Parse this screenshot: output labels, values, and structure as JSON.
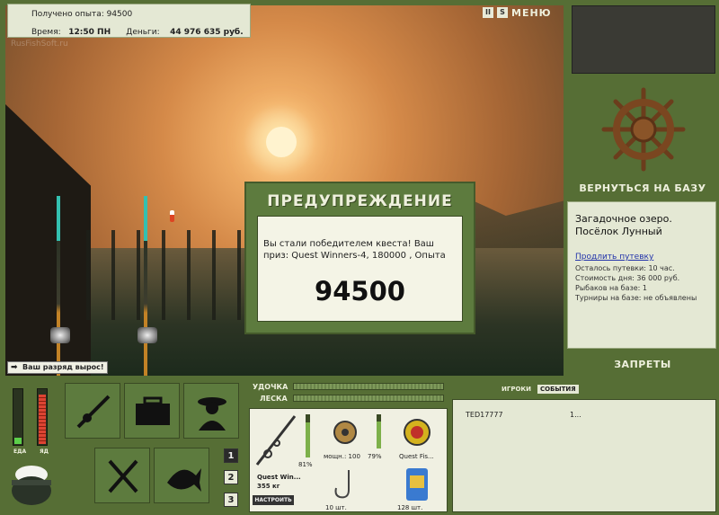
{
  "hud": {
    "xp_text": "Получено опыта: 94500",
    "time_label": "Время:",
    "time_value": "12:50 ПН",
    "money_label": "Деньги:",
    "money_value": "44 976 635 руб.",
    "pause_glyph": "II",
    "sound_glyph": "S",
    "menu_label": "МЕНЮ"
  },
  "scene": {
    "watermark": "RusFishSoft.ru"
  },
  "rank_notice": "Ваш разряд вырос!",
  "warning": {
    "title": "ПРЕДУПРЕЖДЕНИЕ",
    "message": "Вы стали победителем квеста! Ваш приз: Quest Winners-4, 180000 , Опыта",
    "amount": "94500"
  },
  "right_panel": {
    "return_label": "ВЕРНУТЬСЯ НА БАЗУ",
    "location": "Загадочное озеро. Посёлок Лунный",
    "extend_link": "Продлить путевку",
    "info_lines": [
      "Осталось путевки: 10 час.",
      "Стоимость дня: 36 000 руб.",
      "Рыбаков на базе: 1",
      "Турниры на базе: не объявлены"
    ],
    "bans_label": "ЗАПРЕТЫ"
  },
  "meters": {
    "food_label": "ЕДА",
    "poison_label": "ЯД",
    "food_level": 0.12,
    "poison_level": 0.92
  },
  "slots_tabs": [
    "1",
    "2",
    "3"
  ],
  "tackle": {
    "rod_label": "УДОЧКА",
    "line_label": "ЛЕСКА",
    "rod_name": "Quest Win...",
    "rod_weight": "355 кг",
    "rod_percent": "81%",
    "reel_text": "мощн.: 100",
    "reel_percent": "79%",
    "line_name": "Quest Fis...",
    "hooks_count": "10 шт.",
    "bait_count": "128 шт.",
    "setup_label": "НАСТРОИТЬ",
    "rod_level": 0.81,
    "reel_level": 0.79
  },
  "players": {
    "tabs": [
      "ИГРОКИ",
      "СОБЫТИЯ"
    ],
    "rows": [
      {
        "name": "TED17777",
        "value": "1..."
      }
    ]
  }
}
